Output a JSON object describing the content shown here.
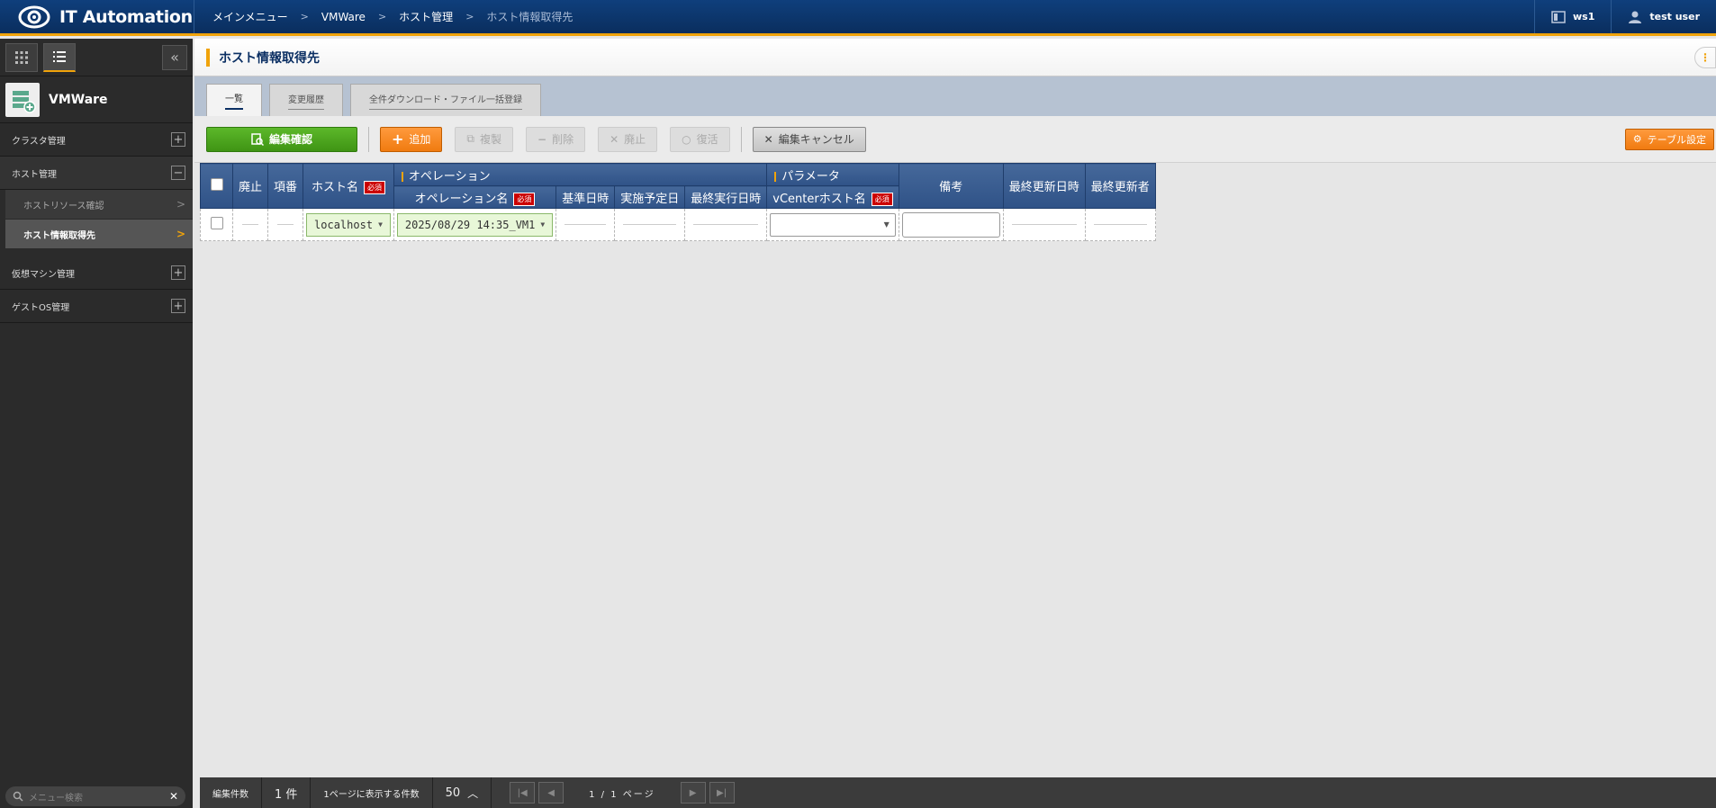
{
  "app": {
    "title": "IT Automation",
    "workspace": "ws1",
    "user": "test user"
  },
  "breadcrumb": [
    "メインメニュー",
    "VMWare",
    "ホスト管理",
    "ホスト情報取得先"
  ],
  "sidebar": {
    "menu_name": "VMWare",
    "groups": [
      {
        "label": "クラスタ管理",
        "toggle": "+"
      },
      {
        "label": "ホスト管理",
        "toggle": "−"
      },
      {
        "label": "仮想マシン管理",
        "toggle": "+"
      },
      {
        "label": "ゲストOS管理",
        "toggle": "+"
      }
    ],
    "sub_items": [
      {
        "label": "ホストリソース確認"
      },
      {
        "label": "ホスト情報取得先"
      }
    ],
    "search_placeholder": "メニュー検索"
  },
  "page": {
    "title": "ホスト情報取得先"
  },
  "tabs": [
    "一覧",
    "変更履歴",
    "全件ダウンロード・ファイル一括登録"
  ],
  "toolbar": {
    "confirm": "編集確認",
    "add": "追加",
    "copy": "複製",
    "delete": "削除",
    "discard": "廃止",
    "restore": "復活",
    "cancel": "編集キャンセル",
    "table_settings": "テーブル設定"
  },
  "table": {
    "headers": {
      "discard": "廃止",
      "item_no": "項番",
      "host_name": "ホスト名",
      "operation_group": "オペレーション",
      "operation_name": "オペレーション名",
      "base_datetime": "基準日時",
      "scheduled_date": "実施予定日",
      "last_exec": "最終実行日時",
      "parameter_group": "パラメータ",
      "vcenter_host": "vCenterホスト名",
      "remarks": "備考",
      "last_updated": "最終更新日時",
      "last_updater": "最終更新者"
    },
    "required_label": "必須",
    "row": {
      "host_name": "localhost",
      "operation_name": "2025/08/29 14:35_VM1"
    }
  },
  "footer": {
    "edit_count_label": "編集件数",
    "edit_count": "1 件",
    "per_page_label": "1ページに表示する件数",
    "per_page": "50",
    "page_info": "1 / 1 ページ"
  }
}
